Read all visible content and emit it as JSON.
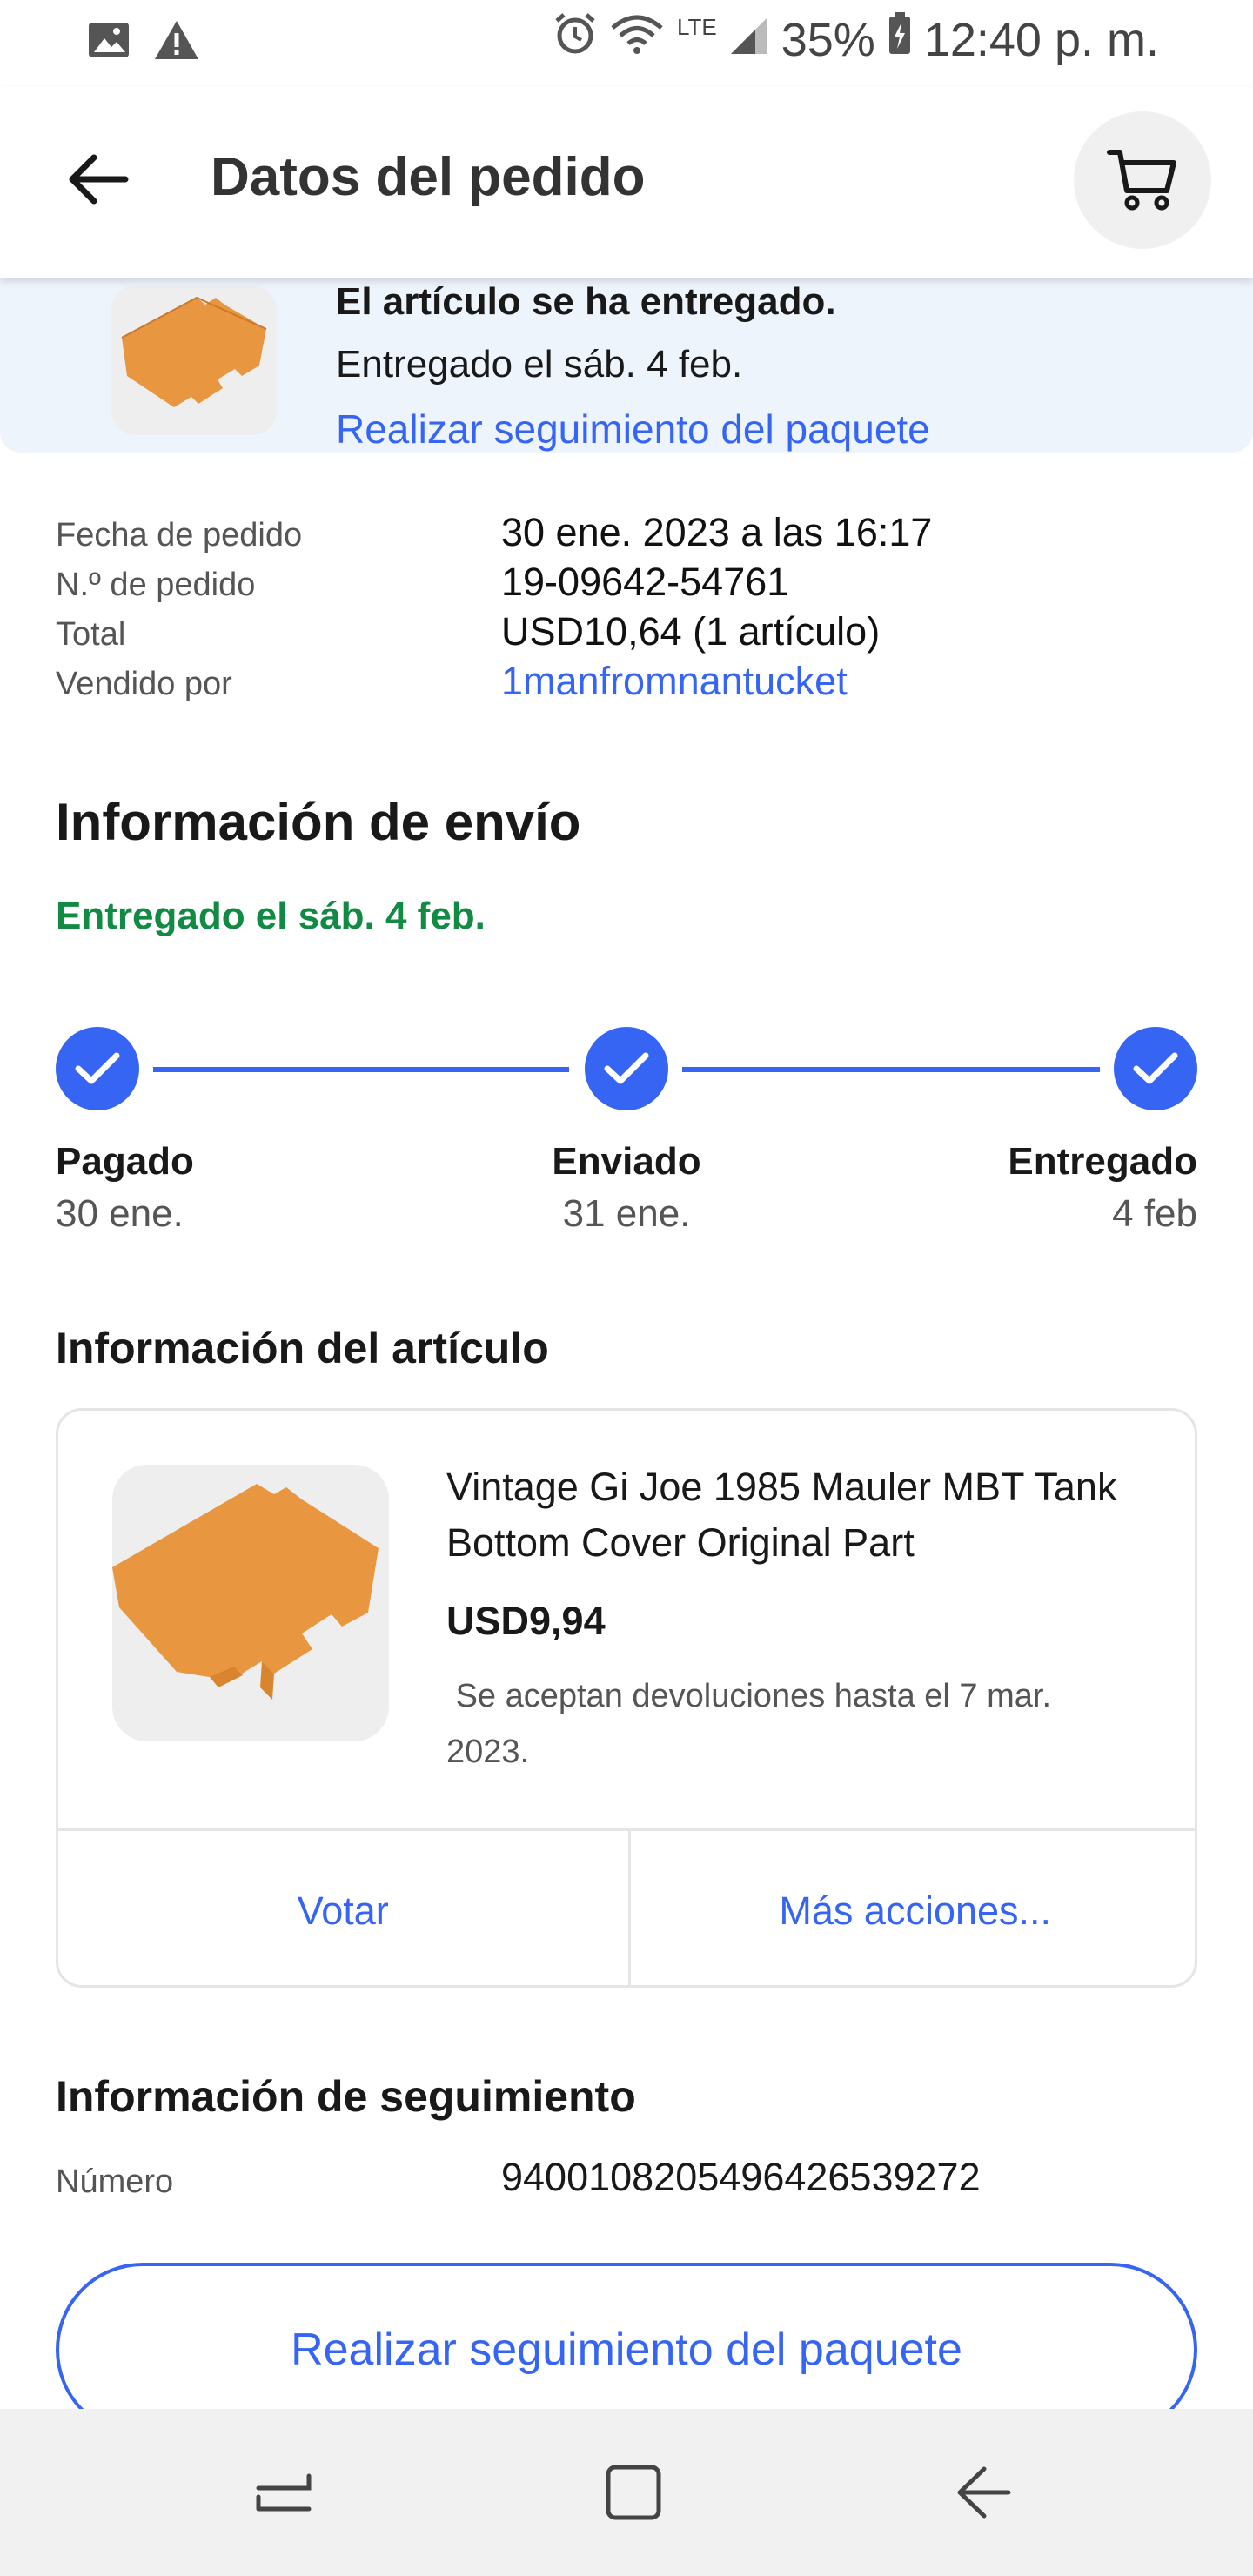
{
  "status_bar": {
    "battery": "35%",
    "time": "12:40 p. m.",
    "network": "LTE",
    "icons": [
      "image-icon",
      "warning-icon",
      "alarm-icon",
      "wifi-icon",
      "signal-icon",
      "battery-icon"
    ]
  },
  "header": {
    "title": "Datos del pedido",
    "back_icon": "arrow-left-icon",
    "cart_icon": "cart-icon"
  },
  "banner": {
    "title": "El artículo se ha entregado.",
    "subtitle": "Entregado el sáb. 4 feb.",
    "link": "Realizar seguimiento del paquete"
  },
  "summary": [
    {
      "label": "Fecha de pedido",
      "value": "30 ene. 2023 a las 16:17"
    },
    {
      "label": "N.º de pedido",
      "value": "19-09642-54761"
    },
    {
      "label": "Total",
      "value": "USD10,64 (1 artículo)"
    },
    {
      "label": "Vendido por",
      "value": "1manfromnantucket"
    }
  ],
  "shipping": {
    "title": "Información de envío",
    "status": "Entregado el sáb. 4 feb.",
    "steps": [
      {
        "label": "Pagado",
        "date": "30 ene."
      },
      {
        "label": "Enviado",
        "date": "31 ene."
      },
      {
        "label": "Entregado",
        "date": "4 feb"
      }
    ]
  },
  "item": {
    "section_title": "Información del artículo",
    "title": "Vintage Gi Joe 1985 Mauler MBT Tank Bottom Cover Original Part",
    "price": "USD9,94",
    "returns": " Se aceptan devoluciones hasta el 7 mar. 2023.",
    "actions": [
      "Votar",
      "Más acciones..."
    ]
  },
  "tracking": {
    "section_title": "Información de seguimiento",
    "label": "Número",
    "number": "9400108205496426539272",
    "button": "Realizar seguimiento del paquete"
  },
  "colors": {
    "accent": "#3665f3",
    "success": "#118a44",
    "banner_bg": "#eef4fc",
    "part": "#e8963f"
  }
}
